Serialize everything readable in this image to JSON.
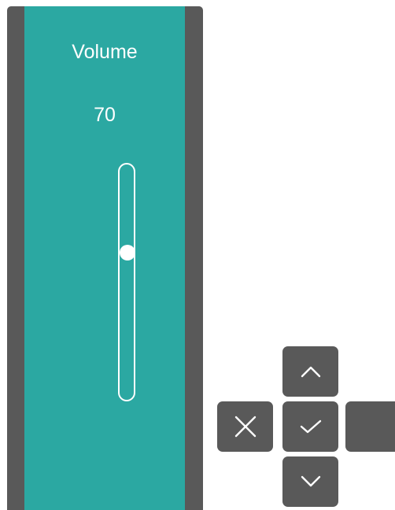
{
  "volume_panel": {
    "title": "Volume",
    "value_text": "70",
    "level_fraction": 0.7
  },
  "dpad": {
    "up": {
      "icon": "chevron-up-icon"
    },
    "left": {
      "icon": "close-icon"
    },
    "ok": {
      "icon": "check-icon"
    },
    "right": {
      "icon": ""
    },
    "down": {
      "icon": "chevron-down-icon"
    }
  },
  "colors": {
    "panel_accent": "#2ba8a2",
    "panel_frame": "#595959",
    "button_bg": "#595959",
    "foreground": "#ffffff"
  }
}
